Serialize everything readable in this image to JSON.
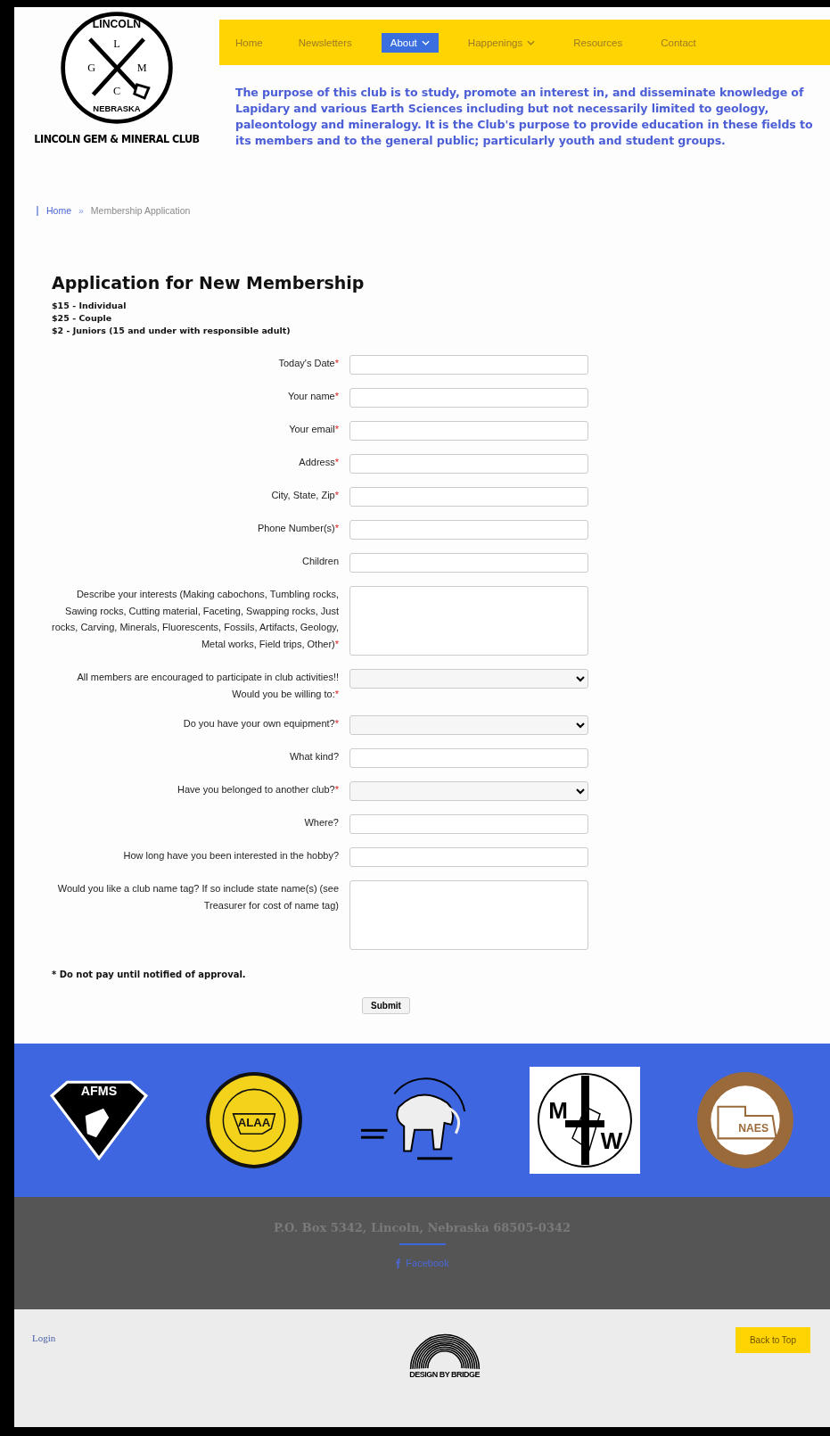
{
  "logo": {
    "top_text": "LINCOLN",
    "bottom_text": "NEBRASKA",
    "letters": [
      "L",
      "G",
      "M",
      "C"
    ],
    "name": "LINCOLN GEM & MINERAL CLUB"
  },
  "nav": [
    {
      "label": "Home",
      "selected": false,
      "dropdown": false
    },
    {
      "label": "Newsletters",
      "selected": false,
      "dropdown": false
    },
    {
      "label": "About",
      "selected": true,
      "dropdown": true
    },
    {
      "label": "Happenings",
      "selected": false,
      "dropdown": true
    },
    {
      "label": "Resources",
      "selected": false,
      "dropdown": false
    },
    {
      "label": "Contact",
      "selected": false,
      "dropdown": false
    }
  ],
  "mission": "The purpose of this club is to study, promote an interest in, and disseminate knowledge of Lapidary and various Earth Sciences including but not necessarily limited to geology, paleontology and mineralogy. It is the Club's purpose to provide education in these fields to its members and to the general public; particularly youth and student groups.",
  "breadcrumb": {
    "home": "Home",
    "separator": "»",
    "current": "Membership Application"
  },
  "form": {
    "title": "Application for New Membership",
    "prices": [
      "$15 - Individual",
      "$25 - Couple",
      "$2 - Juniors (15 and under with responsible adult)"
    ],
    "fields": [
      {
        "kind": "text",
        "label": "Today's Date",
        "required_mark": "*"
      },
      {
        "kind": "text",
        "label": "Your name",
        "required_mark": "*"
      },
      {
        "kind": "text",
        "label": "Your email",
        "required_mark": "*"
      },
      {
        "kind": "text",
        "label": "Address",
        "required_mark": "*"
      },
      {
        "kind": "text",
        "label": "City, State, Zip",
        "required_mark": "*"
      },
      {
        "kind": "text",
        "label": "Phone Number(s)",
        "required_mark": "*"
      },
      {
        "kind": "text",
        "label": "Children"
      },
      {
        "kind": "textarea",
        "label": "Describe your interests (Making cabochons, Tumbling rocks, Sawing rocks, Cutting material, Faceting, Swapping rocks, Just rocks, Carving, Minerals, Fluorescents, Fossils, Artifacts, Geology, Metal works, Field trips, Other)",
        "required_mark": "*"
      },
      {
        "kind": "select",
        "label": "All members are encouraged to participate in club activities!! Would you be willing to:",
        "required_mark": "*"
      },
      {
        "kind": "select",
        "label": "Do you have your own equipment?",
        "required_mark": "*"
      },
      {
        "kind": "text",
        "label": "What kind?"
      },
      {
        "kind": "select",
        "label": "Have you belonged to another club?",
        "required_mark": "*"
      },
      {
        "kind": "text",
        "label": "Where?"
      },
      {
        "kind": "text",
        "label": "How long have you been interested in the hobby?"
      },
      {
        "kind": "textarea",
        "label": "Would you like a club name tag? If so include state name(s) (see Treasurer for cost of name tag)"
      }
    ],
    "notice": "* Do not pay until notified of approval.",
    "submit": "Submit"
  },
  "partners": [
    {
      "kind": "afms",
      "text": "AFMS"
    },
    {
      "kind": "alaa",
      "text": "ALAA"
    },
    {
      "kind": "mammoth"
    },
    {
      "kind": "mfw",
      "text": "M W"
    },
    {
      "kind": "naes",
      "text": "NAES"
    }
  ],
  "footer": {
    "address": "P.O. Box 5342, Lincoln, Nebraska 68505-0342",
    "facebook": "Facebook",
    "login": "Login",
    "credit": "DESIGN BY BRIDGE",
    "back_to_top": "Back to Top"
  }
}
